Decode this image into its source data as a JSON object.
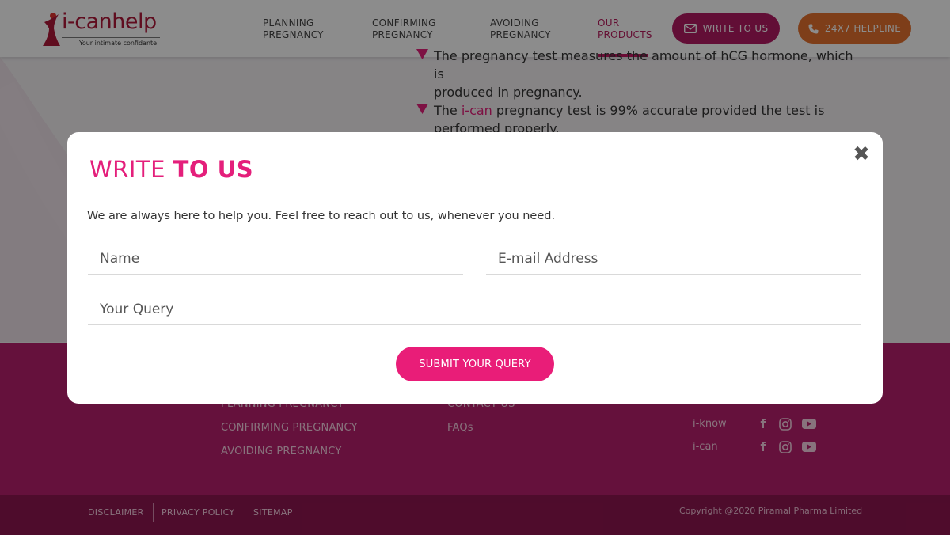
{
  "brand": {
    "logo_text": "i-canhelp",
    "tagline": "Your intimate confidante"
  },
  "nav": {
    "items": [
      {
        "line1": "PLANNING",
        "line2": "PREGNANCY"
      },
      {
        "line1": "CONFIRMING",
        "line2": "PREGNANCY"
      },
      {
        "line1": "AVOIDING",
        "line2": "PREGNANCY"
      },
      {
        "line1": "OUR",
        "line2": "PRODUCTS"
      }
    ],
    "write_button": "WRITE TO US",
    "helpline_button": "24X7 HELPLINE"
  },
  "content": {
    "bullet1_line1": "The pregnancy test measures the amount of hCG hormone, which is",
    "bullet1_line2": "produced in pregnancy.",
    "bullet2_pre": "The ",
    "bullet2_brand": "i-can",
    "bullet2_post": " pregnancy test is 99% accurate provided the test is",
    "bullet2_line2": "performed properly."
  },
  "footer": {
    "col1": [
      "PLANNING PREGNANCY",
      "CONFIRMING PREGNANCY",
      "AVOIDING PREGNANCY"
    ],
    "col2": [
      "CONTACT US",
      "FAQs"
    ],
    "social": [
      "i-know",
      "i-can"
    ],
    "bottom_links": [
      "DISCLAIMER",
      "PRIVACY POLICY",
      "SITEMAP"
    ],
    "copyright": "Copyright @2020 Piramal Pharma Limited"
  },
  "modal": {
    "title_part1": "WRITE ",
    "title_part2": "TO US",
    "description": "We are always here to help you. Feel free to reach out to us, whenever you need.",
    "name_placeholder": "Name",
    "email_placeholder": "E-mail Address",
    "query_placeholder": "Your Query",
    "submit_label": "SUBMIT YOUR QUERY",
    "close_glyph": "✖"
  },
  "colors": {
    "accent_pink": "#e91d78",
    "brand_maroon": "#b31a63",
    "helpline_orange": "#e6722e",
    "footer_bg": "#b81f6d"
  }
}
